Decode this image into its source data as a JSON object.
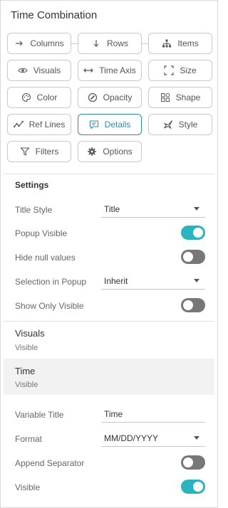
{
  "panel": {
    "title": "Time Combination"
  },
  "chips": {
    "columns": "Columns",
    "rows": "Rows",
    "items": "Items",
    "visuals": "Visuals",
    "time_axis": "Time Axis",
    "size": "Size",
    "color": "Color",
    "opacity": "Opacity",
    "shape": "Shape",
    "ref_lines": "Ref Lines",
    "details": "Details",
    "style": "Style",
    "filters": "Filters",
    "options": "Options"
  },
  "settings": {
    "heading": "Settings",
    "title_style_label": "Title Style",
    "title_style_value": "Title",
    "popup_visible_label": "Popup Visible",
    "popup_visible_on": true,
    "hide_null_label": "Hide null values",
    "hide_null_on": false,
    "selection_popup_label": "Selection in Popup",
    "selection_popup_value": "Inherit",
    "show_only_visible_label": "Show Only Visible",
    "show_only_visible_on": false
  },
  "visuals_group": {
    "title": "Visuals",
    "subtitle": "Visible"
  },
  "time_group": {
    "title": "Time",
    "subtitle": "Visible"
  },
  "time_settings": {
    "variable_title_label": "Variable Title",
    "variable_title_value": "Time",
    "format_label": "Format",
    "format_value": "MM/DD/YYYY",
    "append_separator_label": "Append Separator",
    "append_separator_on": false,
    "visible_label": "Visible",
    "visible_on": true
  },
  "colors": {
    "accent": "#2a8fa5",
    "toggle_on": "#2bb3bf",
    "toggle_off": "#777777"
  }
}
